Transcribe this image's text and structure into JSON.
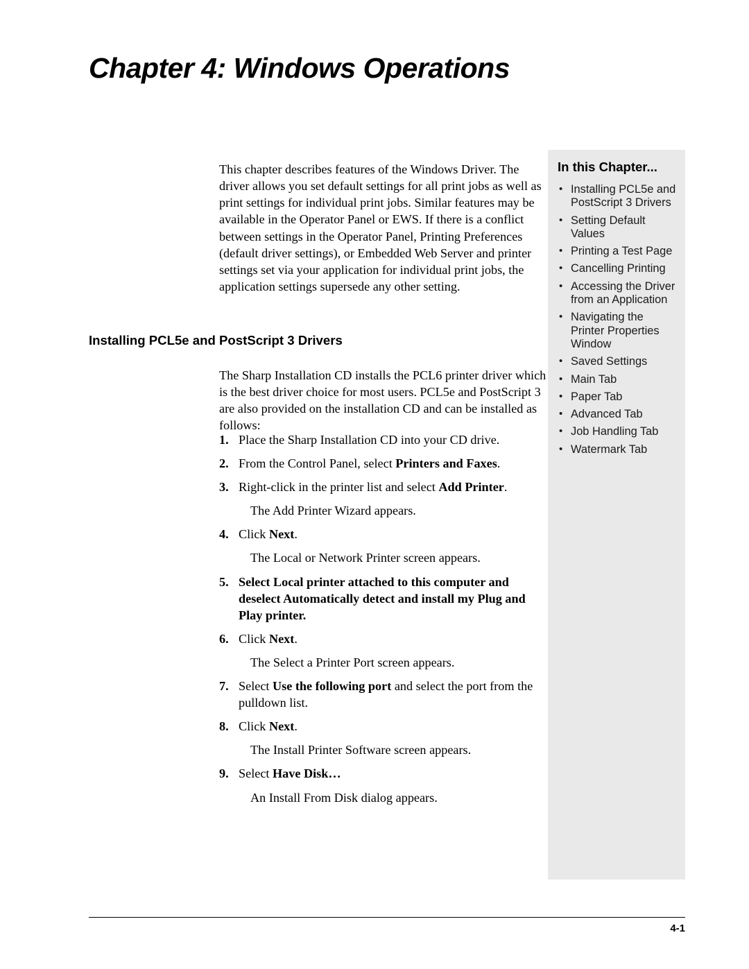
{
  "chapter": {
    "title": "Chapter 4: Windows Operations"
  },
  "intro": {
    "paragraph": "This chapter describes features of the Windows Driver. The driver allows you set default settings for all print jobs as well as print settings for individual print jobs. Similar features may be available in the Operator Panel or EWS. If there is a conflict between settings in the Operator Panel, Printing Preferences (default driver settings), or Embedded Web Server and printer settings set via your application for individual print jobs, the application settings supersede any other setting."
  },
  "section": {
    "heading": "Installing PCL5e and PostScript 3 Drivers",
    "paragraph": "The Sharp Installation CD installs the PCL6 printer driver which is the best driver choice for most users. PCL5e and PostScript 3 are also provided on the installation CD and can be installed as follows:"
  },
  "steps": [
    {
      "num": "1.",
      "text": "Place the Sharp Installation CD into your CD drive."
    },
    {
      "num": "2.",
      "text": "From the Control Panel, select <b>Printers and Faxes</b>."
    },
    {
      "num": "3.",
      "text": "Right-click in the printer list and select <b>Add Printer</b>."
    },
    {
      "num": "",
      "text": "The Add Printer Wizard appears.",
      "sub": true
    },
    {
      "num": "4.",
      "text": "Click <b>Next</b>."
    },
    {
      "num": "",
      "text": "The Local or Network Printer screen appears.",
      "sub": true
    },
    {
      "num": "5.",
      "text": "Select <b>Local printer attached to this computer</b> and deselect <b>Automatically detect and install my Plug and Play printer</b>.",
      "bold": true
    },
    {
      "num": "6.",
      "text": "Click <b>Next</b>."
    },
    {
      "num": "",
      "text": "The Select a Printer Port screen appears.",
      "sub": true
    },
    {
      "num": "7.",
      "text": "Select <b>Use the following port</b> and select the port from the pulldown list."
    },
    {
      "num": "8.",
      "text": "Click <b>Next</b>."
    },
    {
      "num": "",
      "text": "The Install Printer Software screen appears.",
      "sub": true
    },
    {
      "num": "9.",
      "text": "Select <b>Have Disk…</b>"
    },
    {
      "num": "",
      "text": "An Install From Disk dialog appears.",
      "sub": true
    }
  ],
  "sidebar": {
    "heading": "In this Chapter...",
    "items": [
      "Installing PCL5e and PostScript 3 Drivers",
      "Setting Default Values",
      "Printing a Test Page",
      "Cancelling Printing",
      "Accessing the Driver from an Application",
      "Navigating the Printer Properties Window",
      "Saved Settings",
      "Main Tab",
      "Paper Tab",
      "Advanced Tab",
      "Job Handling Tab",
      "Watermark Tab"
    ],
    "background_color": "#e9e9e9"
  },
  "footer": {
    "page_number": "4-1"
  }
}
